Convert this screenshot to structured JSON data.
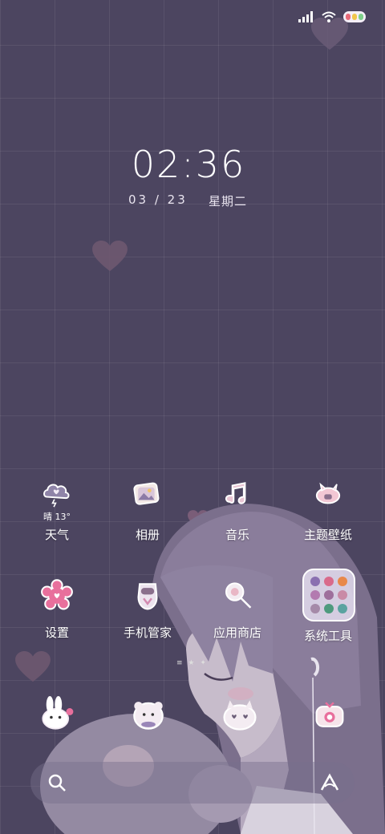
{
  "status_bar": {
    "signal_icon": "signal-icon",
    "wifi_icon": "wifi-icon",
    "battery_icon": "battery-icon"
  },
  "lock": {
    "time": "02:36",
    "date": "03 / 23",
    "weekday": "星期二"
  },
  "apps": [
    {
      "label": "天气",
      "icon": "weather-cloud-icon",
      "sub": "晴 13°"
    },
    {
      "label": "相册",
      "icon": "gallery-icon"
    },
    {
      "label": "音乐",
      "icon": "music-icon"
    },
    {
      "label": "主题壁纸",
      "icon": "theme-icon"
    },
    {
      "label": "设置",
      "icon": "settings-flower-icon"
    },
    {
      "label": "手机管家",
      "icon": "phone-manager-icon"
    },
    {
      "label": "应用商店",
      "icon": "app-store-icon"
    },
    {
      "label": "系统工具",
      "icon": "system-tools-folder-icon"
    }
  ],
  "dock_apps": [
    {
      "icon": "bunny-sticker-icon"
    },
    {
      "icon": "bear-sticker-icon"
    },
    {
      "icon": "cat-sticker-icon"
    },
    {
      "icon": "camera-sticker-icon"
    }
  ],
  "dock": {
    "search_icon": "search-icon",
    "assistant_icon": "assistant-icon"
  },
  "colors": {
    "background": "#4c4560",
    "accent_pink": "#e88fb0",
    "folder_bg": "#ebe4f5"
  }
}
